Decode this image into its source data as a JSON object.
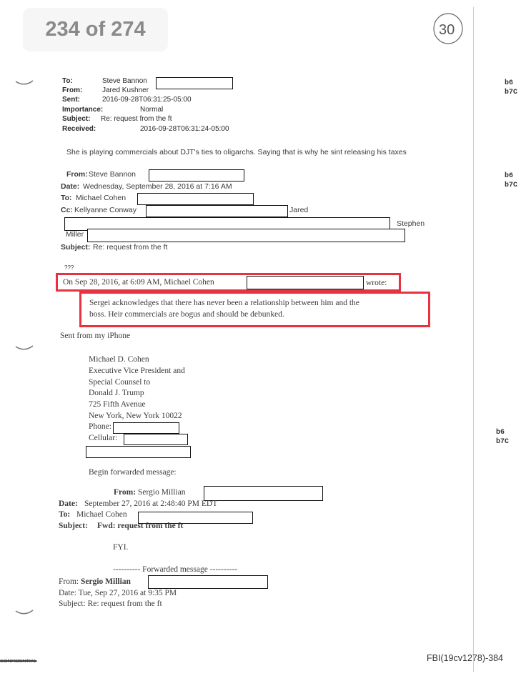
{
  "viewer": {
    "page_indicator": "234 of 274"
  },
  "document": {
    "page_mark": "30",
    "header": {
      "to_label": "To:",
      "to_value": "Steve Bannon",
      "from_label": "From:",
      "from_value": "Jared Kushner",
      "sent_label": "Sent:",
      "sent_value": "2016-09-28T06:31:25-05:00",
      "importance_label": "Importance:",
      "importance_value": "Normal",
      "subject_label": "Subject:",
      "subject_value": "Re: request from the ft",
      "received_label": "Received:",
      "received_value": "2016-09-28T06:31:24-05:00"
    },
    "body": "She is playing commercials about DJT's ties to oligarchs. Saying that is why he sint releasing his taxes",
    "reply1": {
      "from_label": "From:",
      "from_value": "Steve Bannon",
      "date_label": "Date:",
      "date_value": "Wednesday, September 28, 2016 at 7:16 AM",
      "to_label": "To:",
      "to_value": "Michael Cohen",
      "cc_label": "Cc:",
      "cc_value": "Kellyanne Conway",
      "cc_jared": "Jared",
      "cc_stephen": "Stephen",
      "cc_miller": "Miller",
      "subject_label": "Subject:",
      "subject_value": "Re: request from the ft",
      "body": "???"
    },
    "quote": {
      "wrote_prefix": "On Sep 28, 2016, at 6:09 AM, Michael Cohen",
      "wrote_suffix": "wrote:",
      "line1": "Sergei acknowledges that there has never been a relationship between him and the",
      "line2": "boss. Heir commercials are bogus and should be debunked."
    },
    "sent_from": "Sent from my iPhone",
    "signature": [
      "Michael D. Cohen",
      "Executive Vice President and",
      "Special Counsel to",
      "Donald J. Trump",
      "725 Fifth Avenue",
      "New York, New York 10022",
      "Phone:",
      "Cellular:"
    ],
    "forward_intro": "Begin forwarded message:",
    "fwd1": {
      "from_label": "From:",
      "from_value": "Sergio Millian",
      "date_label": "Date:",
      "date_value": "September 27, 2016 at 2:48:40 PM EDT",
      "to_label": "To:",
      "to_value": "Michael Cohen",
      "subject_label": "Subject:",
      "subject_value": "Fwd: request from the ft",
      "body": "FYI."
    },
    "fwd2": {
      "divider": "---------- Forwarded message ----------",
      "from_label": "From:",
      "from_value": "Sergio Millian",
      "date": "Date: Tue, Sep 27, 2016 at 9:35 PM",
      "subject": "Subject: Re: request from the ft"
    },
    "exemptions": [
      [
        "b6",
        "b7C"
      ],
      [
        "b6",
        "b7C"
      ],
      [
        "b6",
        "b7C"
      ]
    ],
    "bates": "FBI(19cv1278)-384",
    "classification": "CONFIDENTIAL",
    "highlight_color": "#e8323f"
  }
}
